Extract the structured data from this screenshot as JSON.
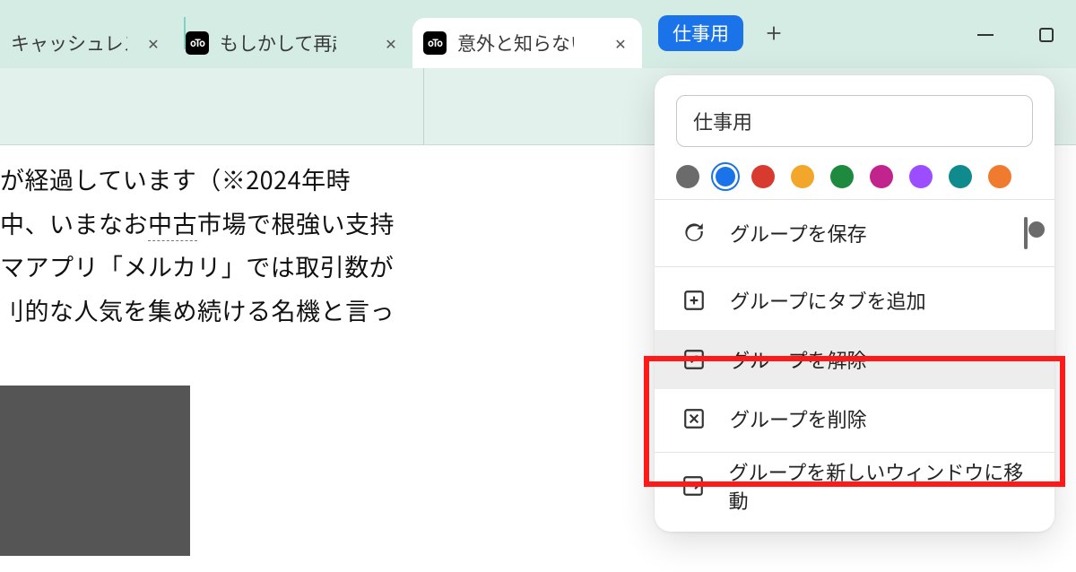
{
  "tabs": {
    "t1": {
      "title": "キャッシュレス決"
    },
    "t2": {
      "title": "もしかして再起",
      "favicon": "oTo"
    },
    "t3": {
      "title": "意外と知らない",
      "favicon": "oTo"
    }
  },
  "group_label": "仕事用",
  "page_lines": {
    "l1": "が経過しています（※2024年時",
    "l2a": "中、いまなお",
    "l2b": "中古",
    "l2c": "市場で根強い支持",
    "l3": "マアプリ「メルカリ」では取引数が",
    "l4": "刂的な人気を集め続ける名機と言っ"
  },
  "popup": {
    "name_value": "仕事用",
    "colors": [
      {
        "hex": "#6b6b6b",
        "selected": false,
        "name": "grey"
      },
      {
        "hex": "#1a73e8",
        "selected": true,
        "name": "blue"
      },
      {
        "hex": "#d83a2f",
        "selected": false,
        "name": "red"
      },
      {
        "hex": "#f2a72b",
        "selected": false,
        "name": "yellow"
      },
      {
        "hex": "#1d8a3e",
        "selected": false,
        "name": "green"
      },
      {
        "hex": "#c2248e",
        "selected": false,
        "name": "pink"
      },
      {
        "hex": "#9b4dff",
        "selected": false,
        "name": "purple"
      },
      {
        "hex": "#0f8a8d",
        "selected": false,
        "name": "cyan"
      },
      {
        "hex": "#f07b2f",
        "selected": false,
        "name": "orange"
      }
    ],
    "items": {
      "save": "グループを保存",
      "addtab": "グループにタブを追加",
      "ungroup": "グループを解除",
      "delete": "グループを削除",
      "move": "グループを新しいウィンドウに移動"
    }
  }
}
